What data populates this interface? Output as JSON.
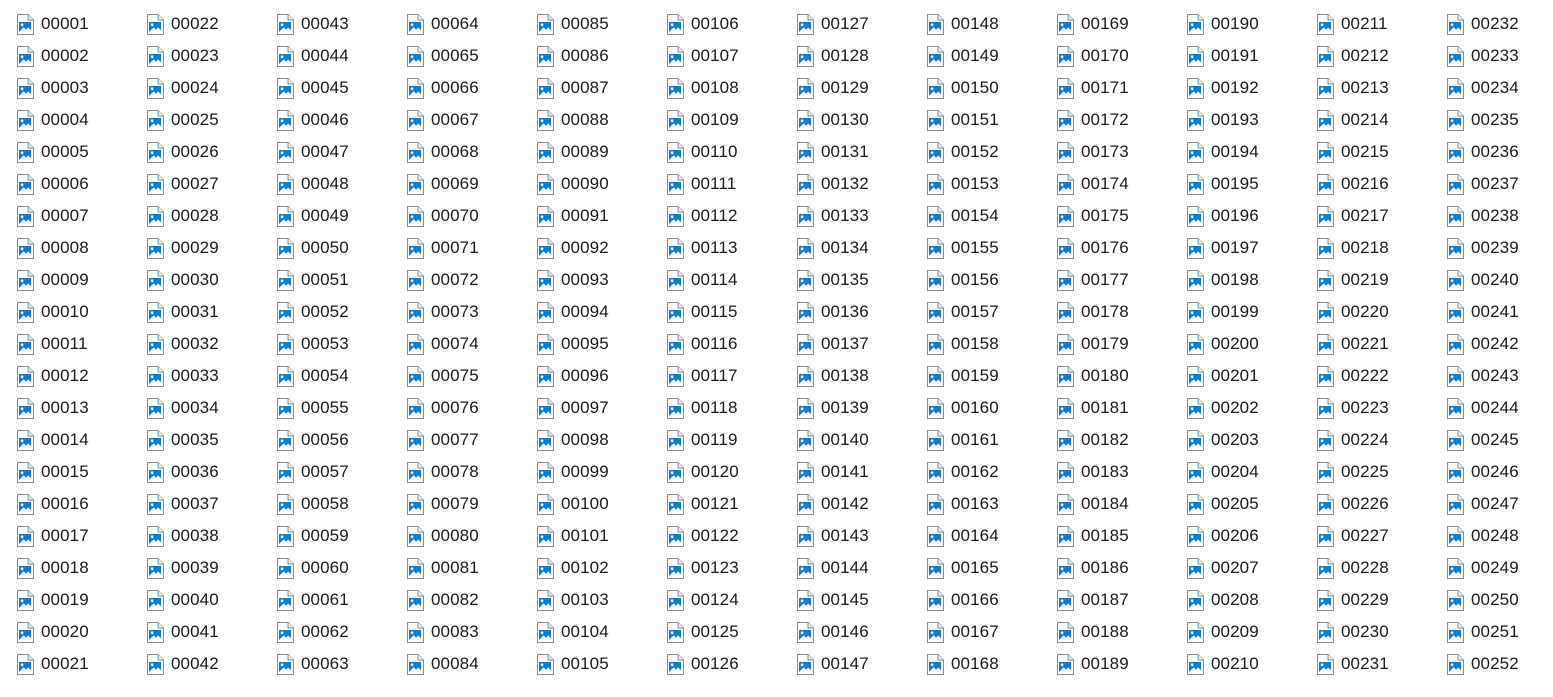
{
  "view": {
    "icon_name": "image-file-icon",
    "accent_color": "#0a7bd6",
    "files": [
      "00001",
      "00002",
      "00003",
      "00004",
      "00005",
      "00006",
      "00007",
      "00008",
      "00009",
      "00010",
      "00011",
      "00012",
      "00013",
      "00014",
      "00015",
      "00016",
      "00017",
      "00018",
      "00019",
      "00020",
      "00021",
      "00022",
      "00023",
      "00024",
      "00025",
      "00026",
      "00027",
      "00028",
      "00029",
      "00030",
      "00031",
      "00032",
      "00033",
      "00034",
      "00035",
      "00036",
      "00037",
      "00038",
      "00039",
      "00040",
      "00041",
      "00042",
      "00043",
      "00044",
      "00045",
      "00046",
      "00047",
      "00048",
      "00049",
      "00050",
      "00051",
      "00052",
      "00053",
      "00054",
      "00055",
      "00056",
      "00057",
      "00058",
      "00059",
      "00060",
      "00061",
      "00062",
      "00063",
      "00064",
      "00065",
      "00066",
      "00067",
      "00068",
      "00069",
      "00070",
      "00071",
      "00072",
      "00073",
      "00074",
      "00075",
      "00076",
      "00077",
      "00078",
      "00079",
      "00080",
      "00081",
      "00082",
      "00083",
      "00084",
      "00085",
      "00086",
      "00087",
      "00088",
      "00089",
      "00090",
      "00091",
      "00092",
      "00093",
      "00094",
      "00095",
      "00096",
      "00097",
      "00098",
      "00099",
      "00100",
      "00101",
      "00102",
      "00103",
      "00104",
      "00105",
      "00106",
      "00107",
      "00108",
      "00109",
      "00110",
      "00111",
      "00112",
      "00113",
      "00114",
      "00115",
      "00116",
      "00117",
      "00118",
      "00119",
      "00120",
      "00121",
      "00122",
      "00123",
      "00124",
      "00125",
      "00126",
      "00127",
      "00128",
      "00129",
      "00130",
      "00131",
      "00132",
      "00133",
      "00134",
      "00135",
      "00136",
      "00137",
      "00138",
      "00139",
      "00140",
      "00141",
      "00142",
      "00143",
      "00144",
      "00145",
      "00146",
      "00147",
      "00148",
      "00149",
      "00150",
      "00151",
      "00152",
      "00153",
      "00154",
      "00155",
      "00156",
      "00157",
      "00158",
      "00159",
      "00160",
      "00161",
      "00162",
      "00163",
      "00164",
      "00165",
      "00166",
      "00167",
      "00168",
      "00169",
      "00170",
      "00171",
      "00172",
      "00173",
      "00174",
      "00175",
      "00176",
      "00177",
      "00178",
      "00179",
      "00180",
      "00181",
      "00182",
      "00183",
      "00184",
      "00185",
      "00186",
      "00187",
      "00188",
      "00189",
      "00190",
      "00191",
      "00192",
      "00193",
      "00194",
      "00195",
      "00196",
      "00197",
      "00198",
      "00199",
      "00200",
      "00201",
      "00202",
      "00203",
      "00204",
      "00205",
      "00206",
      "00207",
      "00208",
      "00209",
      "00210",
      "00211",
      "00212",
      "00213",
      "00214",
      "00215",
      "00216",
      "00217",
      "00218",
      "00219",
      "00220",
      "00221",
      "00222",
      "00223",
      "00224",
      "00225",
      "00226",
      "00227",
      "00228",
      "00229",
      "00230",
      "00231",
      "00232",
      "00233",
      "00234",
      "00235",
      "00236",
      "00237",
      "00238",
      "00239",
      "00240",
      "00241",
      "00242",
      "00243",
      "00244",
      "00245",
      "00246",
      "00247",
      "00248",
      "00249",
      "00250",
      "00251",
      "00252"
    ]
  }
}
